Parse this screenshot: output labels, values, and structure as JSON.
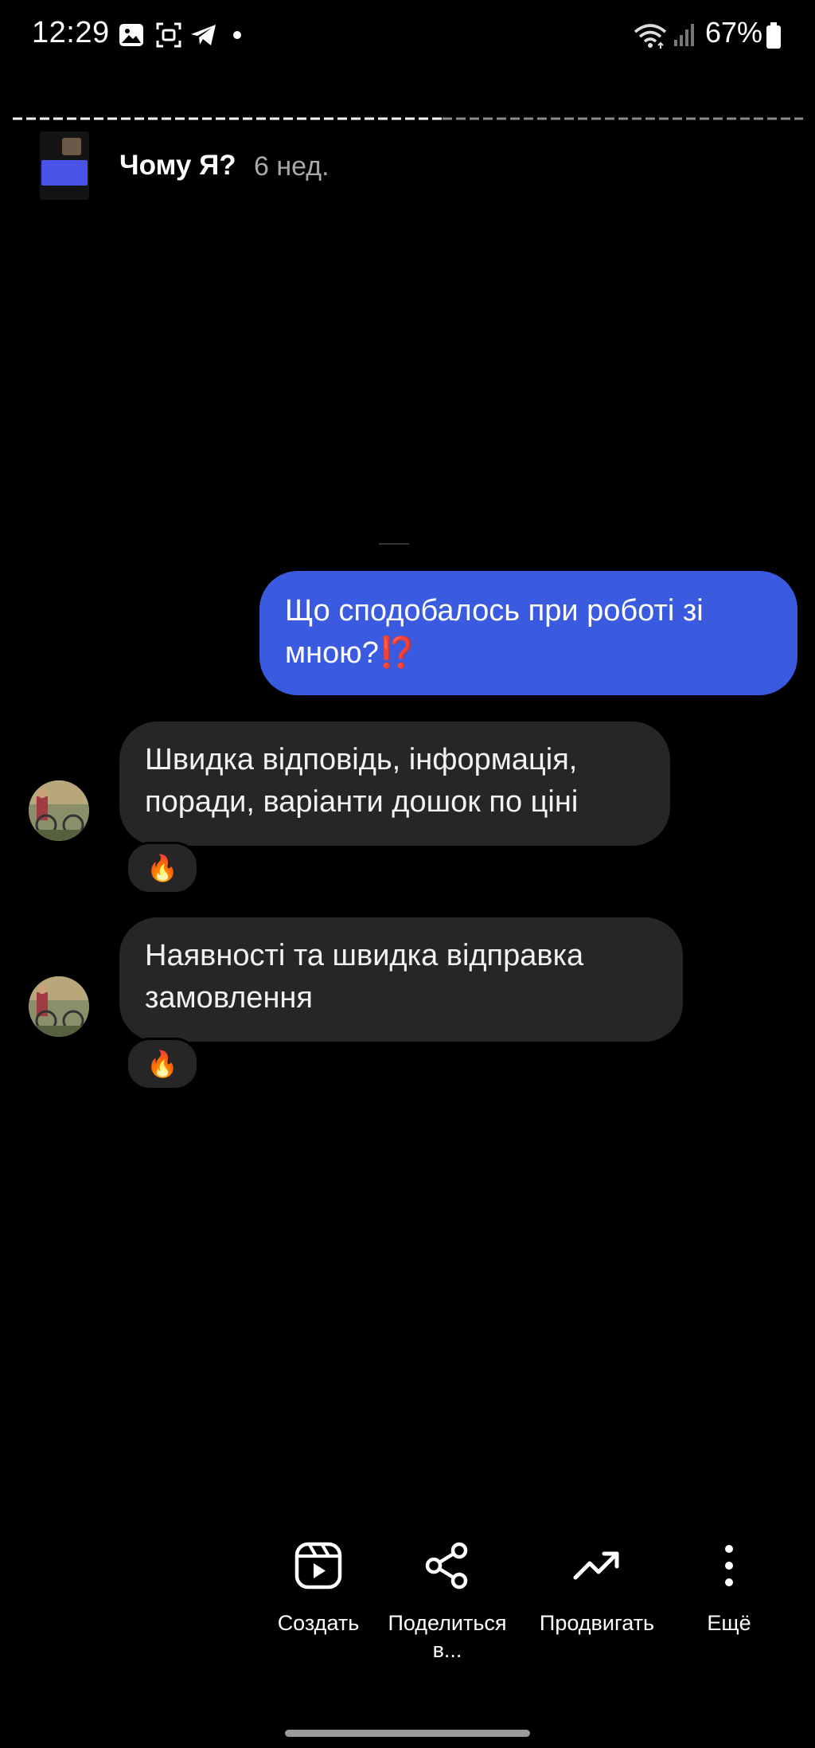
{
  "status_bar": {
    "time": "12:29",
    "battery": "67%",
    "icons": [
      "gallery-icon",
      "screenshot-icon",
      "telegram-icon",
      "dot-icon",
      "wifi-icon",
      "signal-icon",
      "battery-icon"
    ]
  },
  "story": {
    "title": "Чому Я?",
    "age": "6 нед."
  },
  "chat": {
    "question": "Що сподобалось при роботі зі мною?",
    "question_marks": "⁉️",
    "replies": [
      {
        "text": "Швидка відповідь, інформація, поради, варіанти дошок по ціні",
        "reaction": "🔥"
      },
      {
        "text": "Наявності та швидка відправка замовлення",
        "reaction": "🔥"
      }
    ]
  },
  "actions": {
    "create": "Создать",
    "share_line1": "Поделиться",
    "share_line2": "в...",
    "promote": "Продвигать",
    "more": "Ещё"
  },
  "colors": {
    "accent_bubble": "#3a5be0",
    "gray_bubble": "#262626",
    "background": "#000000"
  }
}
